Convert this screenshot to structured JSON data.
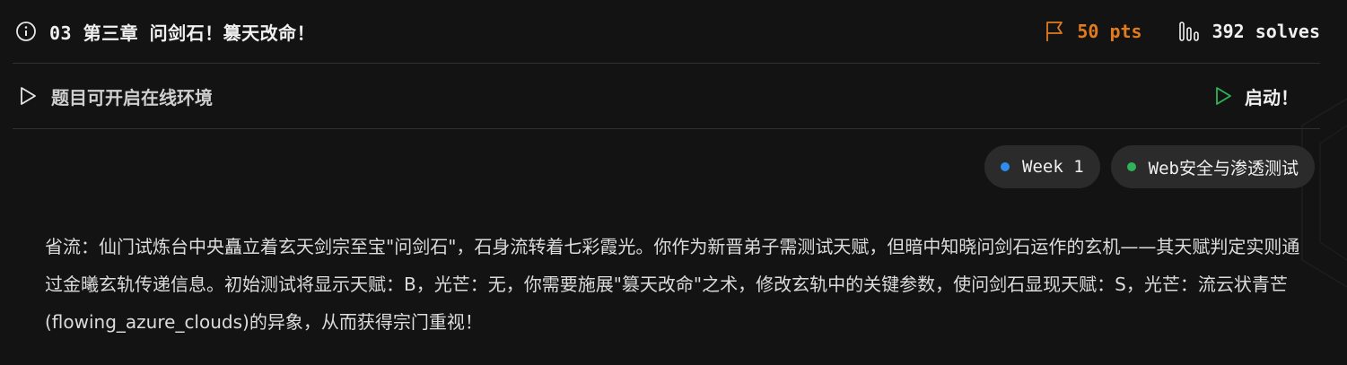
{
  "challenge": {
    "title": "03 第三章 问剑石！篡天改命！",
    "points": "50 pts",
    "solves": "392 solves"
  },
  "environment": {
    "label": "题目可开启在线环境",
    "launch_label": "启动！"
  },
  "tags": [
    {
      "label": "Week 1",
      "color": "#2f8cf0"
    },
    {
      "label": "Web安全与渗透测试",
      "color": "#2eb35a"
    }
  ],
  "description": "省流：仙门试炼台中央矗立着玄天剑宗至宝\"问剑石\"，石身流转着七彩霞光。你作为新晋弟子需测试天赋，但暗中知晓问剑石运作的玄机——其天赋判定实则通过金曦玄轨传递信息。初始测试将显示天赋：B，光芒：无，你需要施展\"篡天改命\"之术，修改玄轨中的关键参数，使问剑石显现天赋：S，光芒：流云状青芒(flowing_azure_clouds)的异象，从而获得宗门重视！",
  "colors": {
    "background": "#131313",
    "points": "#e07b1e",
    "launch_icon": "#2eb35a",
    "tag_bg": "#2b2b2b"
  }
}
